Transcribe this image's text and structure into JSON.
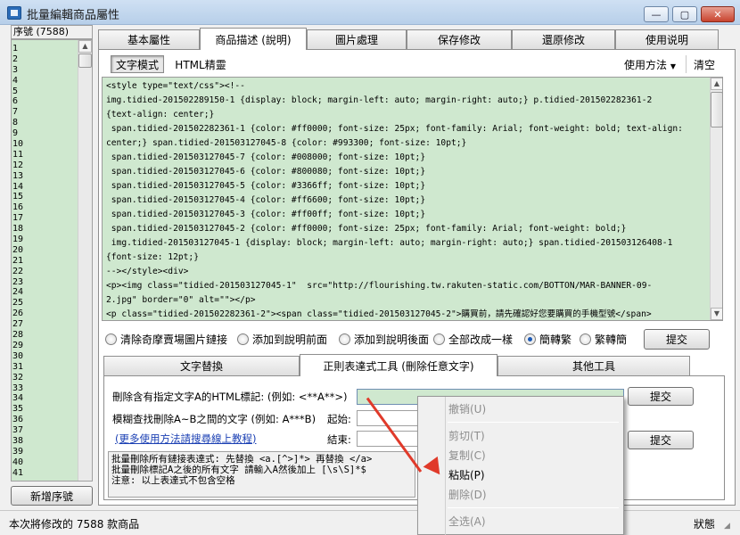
{
  "window": {
    "title": "批量編輯商品屬性",
    "minimize_label": "—",
    "maximize_label": "▢",
    "close_label": "✕"
  },
  "left": {
    "header": "序號 (7588)",
    "numbers": [
      "1",
      "2",
      "3",
      "4",
      "5",
      "6",
      "7",
      "8",
      "9",
      "10",
      "11",
      "12",
      "13",
      "14",
      "15",
      "16",
      "17",
      "18",
      "19",
      "20",
      "21",
      "22",
      "23",
      "24",
      "25",
      "26",
      "27",
      "28",
      "29",
      "30",
      "31",
      "32",
      "33",
      "34",
      "35",
      "36",
      "37",
      "38",
      "39",
      "40",
      "41"
    ],
    "add_button": "新增序號"
  },
  "tabs": [
    {
      "label": "基本屬性"
    },
    {
      "label": "商品描述 (說明)"
    },
    {
      "label": "圖片處理"
    },
    {
      "label": "保存修改"
    },
    {
      "label": "還原修改"
    },
    {
      "label": "使用说明"
    }
  ],
  "toolbar": {
    "text_mode": "文字模式",
    "html_mode": "HTML精靈",
    "usage": "使用方法",
    "clear": "清空"
  },
  "code_lines": [
    "<style type=\"text/css\"><!--",
    "img.tidied-201502289150-1 {display: block; margin-left: auto; margin-right: auto;} p.tidied-201502282361-2",
    "{text-align: center;}",
    " span.tidied-201502282361-1 {color: #ff0000; font-size: 25px; font-family: Arial; font-weight: bold; text-align:",
    "center;} span.tidied-201503127045-8 {color: #993300; font-size: 10pt;}",
    " span.tidied-201503127045-7 {color: #008000; font-size: 10pt;}",
    " span.tidied-201503127045-6 {color: #800080; font-size: 10pt;}",
    " span.tidied-201503127045-5 {color: #3366ff; font-size: 10pt;}",
    " span.tidied-201503127045-4 {color: #ff6600; font-size: 10pt;}",
    " span.tidied-201503127045-3 {color: #ff00ff; font-size: 10pt;}",
    " span.tidied-201503127045-2 {color: #ff0000; font-size: 25px; font-family: Arial; font-weight: bold;}",
    " img.tidied-201503127045-1 {display: block; margin-left: auto; margin-right: auto;} span.tidied-201503126408-1",
    "{font-size: 12pt;}",
    "--></style><div>",
    "<p><img class=\"tidied-201503127045-1\"  src=\"http://flourishing.tw.rakuten-static.com/BOTTON/MAR-BANNER-09-",
    "2.jpg\" border=\"0\" alt=\"\"></p>",
    "<p class=\"tidied-201502282361-2\"><span class=\"tidied-201503127045-2\">購買前，請先確認好您要購買的手機型號</span>"
  ],
  "radios": [
    {
      "label": "清除奇摩賣場圖片鏈接",
      "checked": false
    },
    {
      "label": "添加到說明前面",
      "checked": false
    },
    {
      "label": "添加到說明後面",
      "checked": false
    },
    {
      "label": "全部改成一樣",
      "checked": false
    },
    {
      "label": "簡轉繁",
      "checked": true
    },
    {
      "label": "繁轉簡",
      "checked": false
    }
  ],
  "submit_label": "提交",
  "subtabs": [
    {
      "label": "文字替換"
    },
    {
      "label": "正則表達式工具 (刪除任意文字)"
    },
    {
      "label": "其他工具"
    }
  ],
  "regex_panel": {
    "delete_tag_label": "刪除含有指定文字A的HTML標記: (例如: <**A**>)",
    "fuzzy_label": "模糊查找刪除A~B之間的文字 (例如: A***B)",
    "start_label": "起始:",
    "end_label": "結束:",
    "more_link": "(更多使用方法請搜尋線上教程)",
    "submit1": "提交",
    "submit2": "提交",
    "info_lines": [
      "批量刪除所有鏈接表達式: 先替換 <a.[^>]*> 再替換 </a>",
      "批量刪除標記A之後的所有文字 請輸入A然後加上 [\\s\\S]*$",
      "注意: 以上表達式不包含空格"
    ]
  },
  "context_menu": [
    {
      "label": "撤销(U)",
      "enabled": false
    },
    {
      "label": "剪切(T)",
      "enabled": false
    },
    {
      "label": "复制(C)",
      "enabled": false
    },
    {
      "label": "粘贴(P)",
      "enabled": true
    },
    {
      "label": "删除(D)",
      "enabled": false
    },
    {
      "label": "全选(A)",
      "enabled": false
    }
  ],
  "status": {
    "left": "本次將修改的 7588 款商品",
    "right": "狀態"
  }
}
